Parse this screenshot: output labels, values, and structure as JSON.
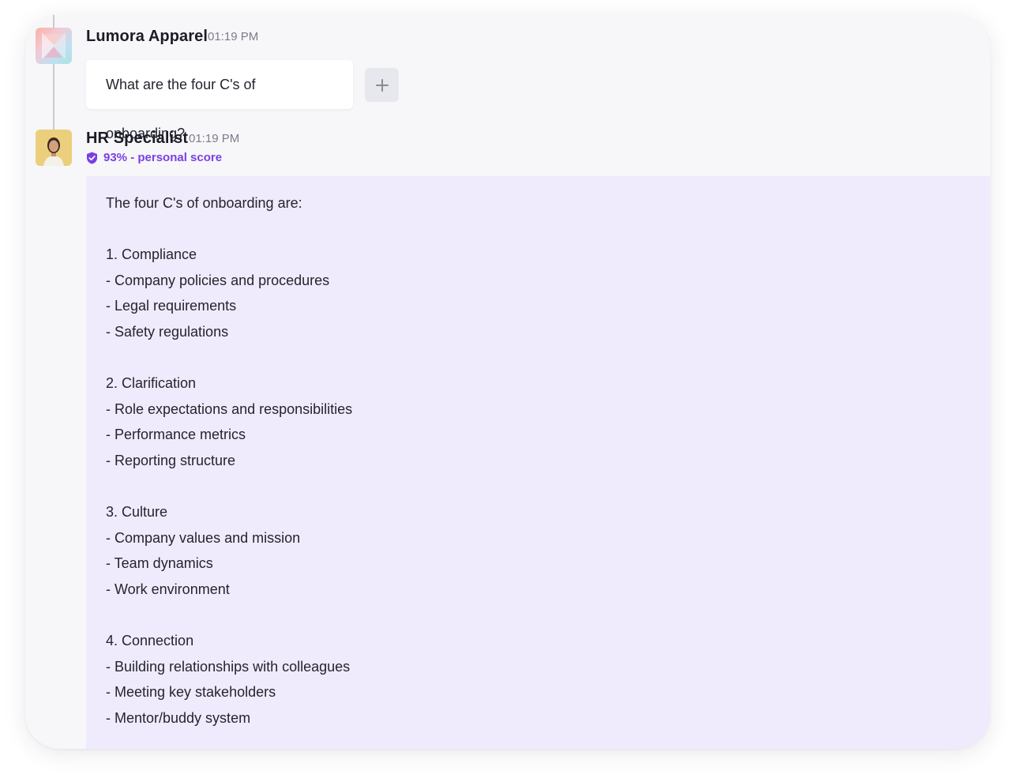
{
  "messages": {
    "user": {
      "sender": "Lumora Apparel",
      "time": "01:19 PM",
      "text": "What are the four C's of onboarding?",
      "add_icon": "plus-icon"
    },
    "assistant": {
      "sender": "HR Specialist",
      "time": "01:19 PM",
      "score_label": "93% - personal score",
      "score_icon": "shield-check-icon",
      "score_color": "#7b3fe4",
      "bubble_color": "#efebfc",
      "lines": [
        "The four C's of onboarding are:",
        "",
        "1. Compliance",
        "- Company policies and procedures",
        "- Legal requirements",
        "- Safety regulations",
        "",
        "2. Clarification",
        "- Role expectations and responsibilities",
        "- Performance metrics",
        "- Reporting structure",
        "",
        "3. Culture",
        "- Company values and mission",
        "- Team dynamics",
        "- Work environment",
        "",
        "4. Connection",
        "- Building relationships with colleagues",
        "- Meeting key stakeholders",
        "- Mentor/buddy system"
      ]
    }
  }
}
